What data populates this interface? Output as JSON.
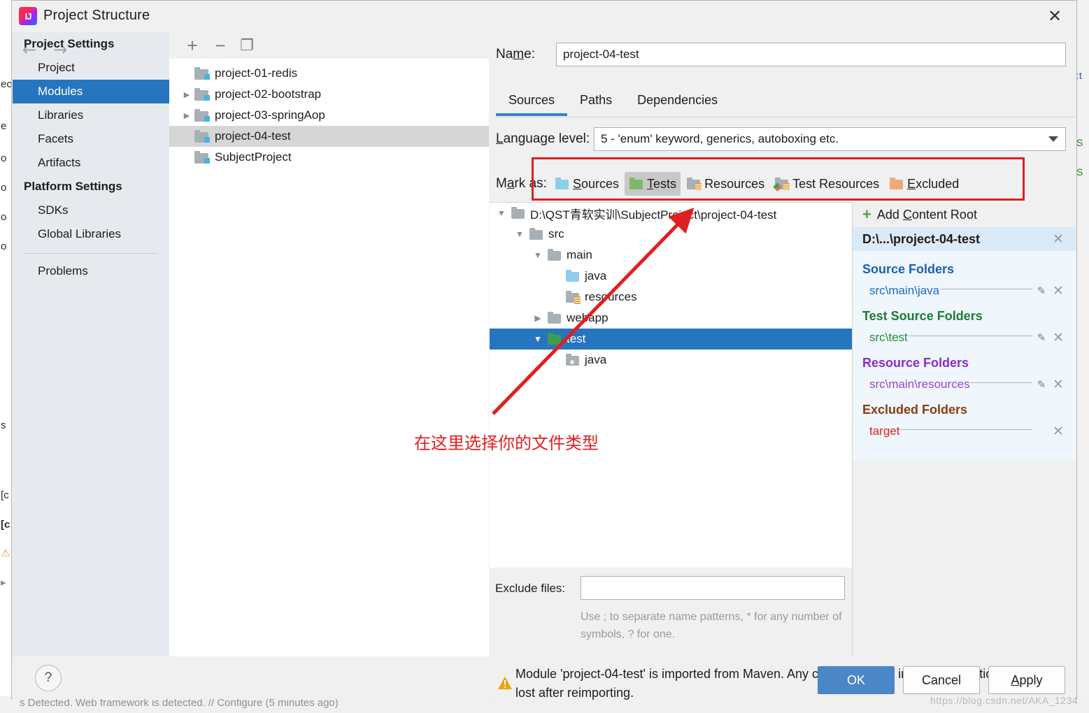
{
  "window": {
    "title": "Project Structure",
    "app_icon": "intellij-idea-icon",
    "close_icon": "close-icon"
  },
  "sidebar": {
    "nav": {
      "back_icon": "arrow-left-icon",
      "forward_icon": "arrow-right-icon"
    },
    "groups": [
      {
        "title": "Project Settings",
        "items": [
          {
            "label": "Project",
            "selected": false
          },
          {
            "label": "Modules",
            "selected": true
          },
          {
            "label": "Libraries",
            "selected": false
          },
          {
            "label": "Facets",
            "selected": false
          },
          {
            "label": "Artifacts",
            "selected": false
          }
        ]
      },
      {
        "title": "Platform Settings",
        "items": [
          {
            "label": "SDKs",
            "selected": false
          },
          {
            "label": "Global Libraries",
            "selected": false
          }
        ]
      }
    ],
    "problems": {
      "label": "Problems"
    }
  },
  "modules_panel": {
    "toolbar": [
      {
        "name": "add-module-button",
        "glyph": "+"
      },
      {
        "name": "remove-module-button",
        "glyph": "−"
      },
      {
        "name": "copy-module-button",
        "glyph": "❐"
      }
    ],
    "items": [
      {
        "label": "project-01-redis",
        "toggle": "",
        "selected": false
      },
      {
        "label": "project-02-bootstrap",
        "toggle": "▶",
        "selected": false
      },
      {
        "label": "project-03-springAop",
        "toggle": "▶",
        "selected": false
      },
      {
        "label": "project-04-test",
        "toggle": "",
        "selected": true
      },
      {
        "label": "SubjectProject",
        "toggle": "",
        "selected": false
      }
    ]
  },
  "detail": {
    "name_label": "Name:",
    "name_value": "project-04-test",
    "tabs": [
      {
        "label": "Sources",
        "active": true
      },
      {
        "label": "Paths",
        "active": false
      },
      {
        "label": "Dependencies",
        "active": false
      }
    ],
    "language_level_label": "Language level:",
    "language_level_value": "5 - 'enum' keyword, generics, autoboxing etc.",
    "mark_as_label": "Mark as:",
    "mark_as_buttons": [
      {
        "label": "Sources",
        "mnemonic": "S",
        "color": "#8ecdeb",
        "kind": "plain",
        "active": false
      },
      {
        "label": "Tests",
        "mnemonic": "T",
        "color": "#7cba6a",
        "kind": "plain",
        "active": true
      },
      {
        "label": "Resources",
        "mnemonic": "",
        "color": "#a8b0b5",
        "kind": "lines",
        "active": false
      },
      {
        "label": "Test Resources",
        "mnemonic": "",
        "color": "#a8b0b5",
        "kind": "test-lines",
        "active": false
      },
      {
        "label": "Excluded",
        "mnemonic": "E",
        "color": "#f0a878",
        "kind": "plain",
        "active": false
      }
    ],
    "source_tree": [
      {
        "label": "D:\\QST青软实训\\SubjectProject\\project-04-test",
        "indent": 0,
        "toggle": "▼",
        "icon": "folder-gray",
        "selected": false
      },
      {
        "label": "src",
        "indent": 1,
        "toggle": "▼",
        "icon": "folder-gray",
        "selected": false
      },
      {
        "label": "main",
        "indent": 2,
        "toggle": "▼",
        "icon": "folder-gray",
        "selected": false
      },
      {
        "label": "java",
        "indent": 3,
        "toggle": "",
        "icon": "folder-blue",
        "selected": false
      },
      {
        "label": "resources",
        "indent": 3,
        "toggle": "",
        "icon": "folder-resources",
        "selected": false
      },
      {
        "label": "webapp",
        "indent": 2,
        "toggle": "▶",
        "icon": "folder-gray",
        "selected": false
      },
      {
        "label": "test",
        "indent": 2,
        "toggle": "▼",
        "icon": "folder-green",
        "selected": true
      },
      {
        "label": "java",
        "indent": 3,
        "toggle": "",
        "icon": "folder-test-java",
        "selected": false
      }
    ],
    "exclude_files_label": "Exclude files:",
    "exclude_files_value": "",
    "exclude_files_hint": "Use ; to separate name patterns, * for any number of symbols, ? for one.",
    "content_roots": {
      "add_label": "Add Content Root",
      "add_mnemonic": "C",
      "root_title": "D:\\...\\project-04-test",
      "remove_root_icon": "close-icon",
      "groups": [
        {
          "title": "Source Folders",
          "color": "#1a5fb4",
          "entries": [
            {
              "path": "src\\main\\java",
              "color": "#2368bf",
              "editable": true
            }
          ]
        },
        {
          "title": "Test Source Folders",
          "color": "#1f7a32",
          "entries": [
            {
              "path": "src\\test",
              "color": "#2a8a3c",
              "editable": true
            }
          ]
        },
        {
          "title": "Resource Folders",
          "color": "#8b2bc9",
          "entries": [
            {
              "path": "src\\main\\resources",
              "color": "#9b44d6",
              "editable": true
            }
          ]
        },
        {
          "title": "Excluded Folders",
          "color": "#8c3a12",
          "entries": [
            {
              "path": "target",
              "color": "#e02020",
              "editable": false
            }
          ]
        }
      ]
    }
  },
  "warning": {
    "icon": "warning-triangle-icon",
    "text": "Module 'project-04-test' is imported from Maven. Any changes made in its configuration may be lost after reimporting."
  },
  "footer": {
    "help_icon": "question-mark-icon",
    "buttons": [
      {
        "label": "OK",
        "mnemonic": "",
        "primary": true
      },
      {
        "label": "Cancel",
        "mnemonic": "",
        "primary": false
      },
      {
        "label": "Apply",
        "mnemonic": "A",
        "primary": false
      }
    ]
  },
  "annotations": {
    "box_color": "#e02020",
    "arrow_color": "#e02020",
    "note_text": "在这里选择你的文件类型",
    "watermark": "https://blog.csdn.net/AKA_1234"
  },
  "background": {
    "bottom_text": "s Detected. Web framework is detected. // Configure (5 minutes ago)",
    "left_fragments": [
      "ec",
      "e",
      "o",
      "o",
      "o",
      "o",
      "s",
      "[c",
      "[c"
    ],
    "right_fragments": [
      ":t",
      "S",
      "S"
    ]
  }
}
